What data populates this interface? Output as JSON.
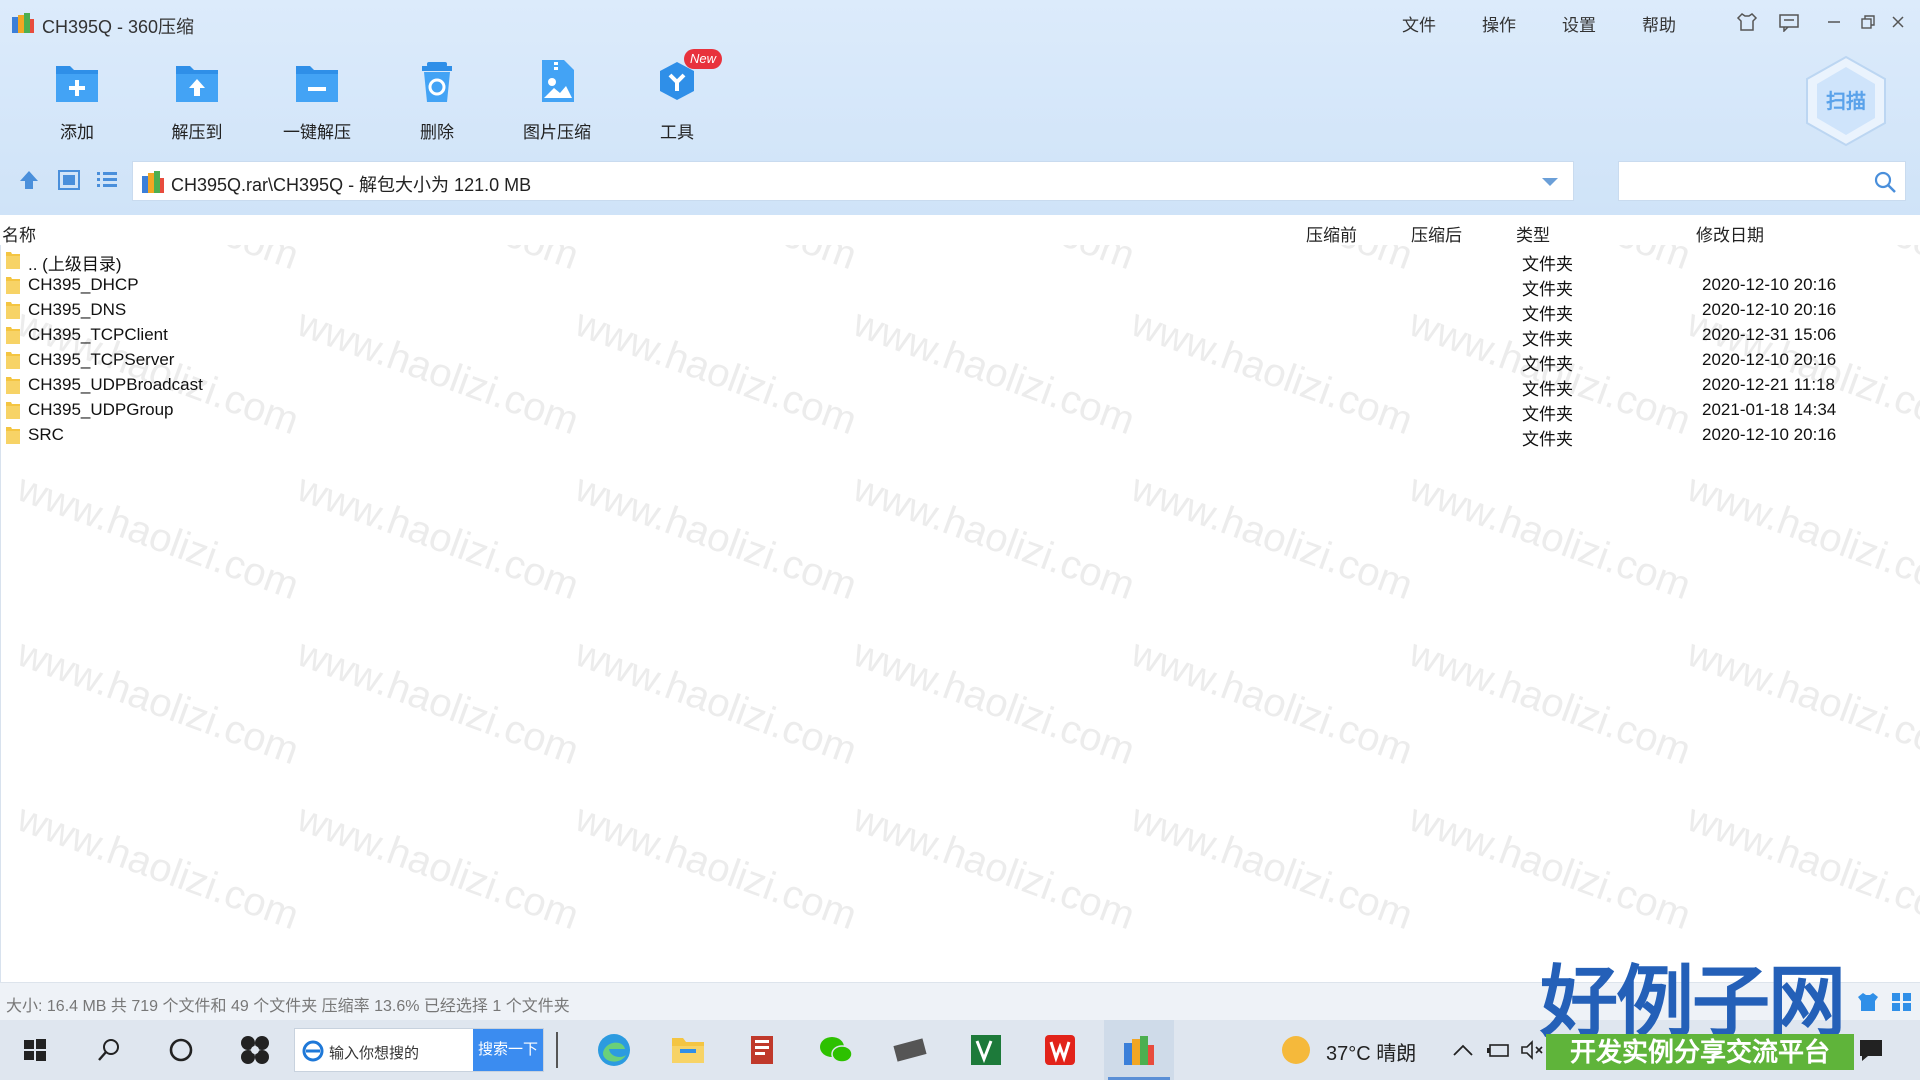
{
  "window": {
    "title": "CH395Q - 360压缩",
    "menu": [
      "文件",
      "操作",
      "设置",
      "帮助"
    ]
  },
  "toolbar": {
    "buttons": [
      {
        "label": "添加",
        "icon": "add-icon"
      },
      {
        "label": "解压到",
        "icon": "extract-to-icon"
      },
      {
        "label": "一键解压",
        "icon": "one-click-extract-icon"
      },
      {
        "label": "删除",
        "icon": "delete-icon"
      },
      {
        "label": "图片压缩",
        "icon": "image-compress-icon"
      },
      {
        "label": "工具",
        "icon": "tools-icon"
      }
    ],
    "new_badge": "New",
    "scan_label": "扫描"
  },
  "address": {
    "path": "CH395Q.rar\\CH395Q - 解包大小为 121.0 MB",
    "search_placeholder": ""
  },
  "columns": {
    "name": "名称",
    "before": "压缩前",
    "after": "压缩后",
    "type": "类型",
    "modified": "修改日期"
  },
  "rows": [
    {
      "name": ".. (上级目录)",
      "type": "文件夹",
      "date": ""
    },
    {
      "name": "CH395_DHCP",
      "type": "文件夹",
      "date": "2020-12-10 20:16"
    },
    {
      "name": "CH395_DNS",
      "type": "文件夹",
      "date": "2020-12-10 20:16"
    },
    {
      "name": "CH395_TCPClient",
      "type": "文件夹",
      "date": "2020-12-31 15:06"
    },
    {
      "name": "CH395_TCPServer",
      "type": "文件夹",
      "date": "2020-12-10 20:16"
    },
    {
      "name": "CH395_UDPBroadcast",
      "type": "文件夹",
      "date": "2020-12-21 11:18"
    },
    {
      "name": "CH395_UDPGroup",
      "type": "文件夹",
      "date": "2021-01-18 14:34"
    },
    {
      "name": "SRC",
      "type": "文件夹",
      "date": "2020-12-10 20:16"
    }
  ],
  "status": {
    "text": "大小: 16.4 MB 共 719 个文件和 49 个文件夹 压缩率 13.6% 已经选择 1 个文件夹"
  },
  "watermark": "www.haolizi.com",
  "taskbar": {
    "search_placeholder": "输入你想搜的",
    "search_button": "搜索一下",
    "weather": "37°C 晴朗"
  },
  "site_logo": {
    "title": "好例子网",
    "subtitle": "开发实例分享交流平台"
  },
  "colors": {
    "header_bg": "#d6e8fa",
    "accent_blue": "#2f8fe8",
    "folder_yellow": "#f4c542",
    "badge_red": "#e8323c"
  }
}
